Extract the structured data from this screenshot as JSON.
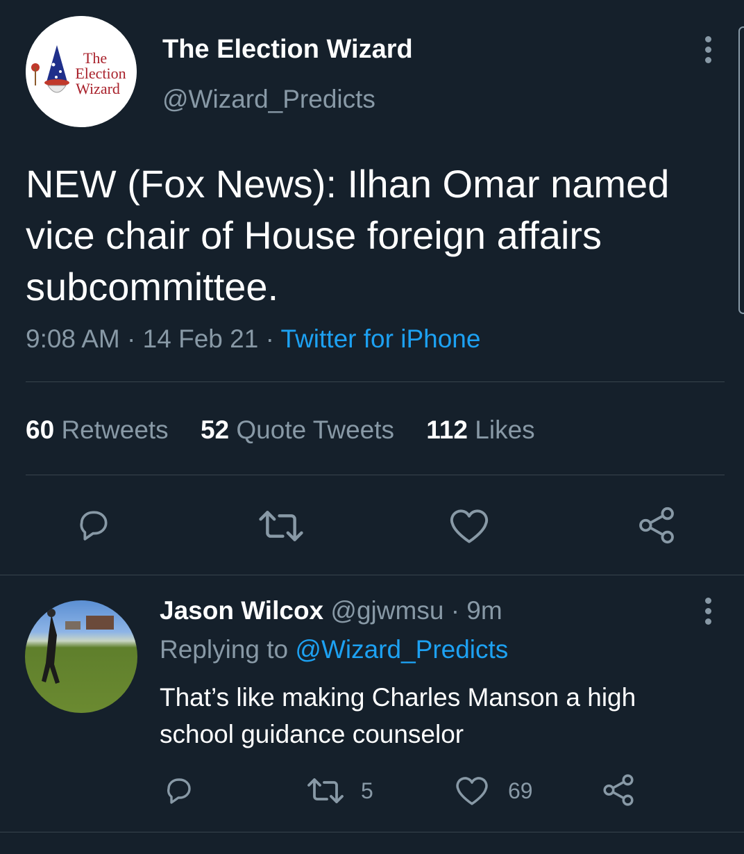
{
  "main_tweet": {
    "author": {
      "name": "The Election Wizard",
      "handle": "@Wizard_Predicts",
      "avatar_text": [
        "The",
        "Election",
        "Wizard"
      ]
    },
    "text": "NEW (Fox News): Ilhan Omar named vice chair of House foreign affairs subcommittee.",
    "time": "9:08 AM",
    "date": "14 Feb 21",
    "separator": "·",
    "source": "Twitter for iPhone",
    "stats": {
      "retweets_count": "60",
      "retweets_label": "Retweets",
      "quotes_count": "52",
      "quotes_label": "Quote Tweets",
      "likes_count": "112",
      "likes_label": "Likes"
    },
    "actions": [
      "reply-icon",
      "retweet-icon",
      "like-icon",
      "share-icon"
    ]
  },
  "reply": {
    "author": {
      "name": "Jason Wilcox",
      "handle": "@gjwmsu"
    },
    "separator": "·",
    "time": "9m",
    "replying_prefix": "Replying to",
    "replying_handle": "@Wizard_Predicts",
    "text": "That’s like making Charles Manson a high school guidance counselor",
    "retweet_count": "5",
    "like_count": "69"
  },
  "colors": {
    "background": "#15202b",
    "text": "#ffffff",
    "muted": "#8899a6",
    "link": "#1da1f2",
    "divider": "#38444d"
  }
}
